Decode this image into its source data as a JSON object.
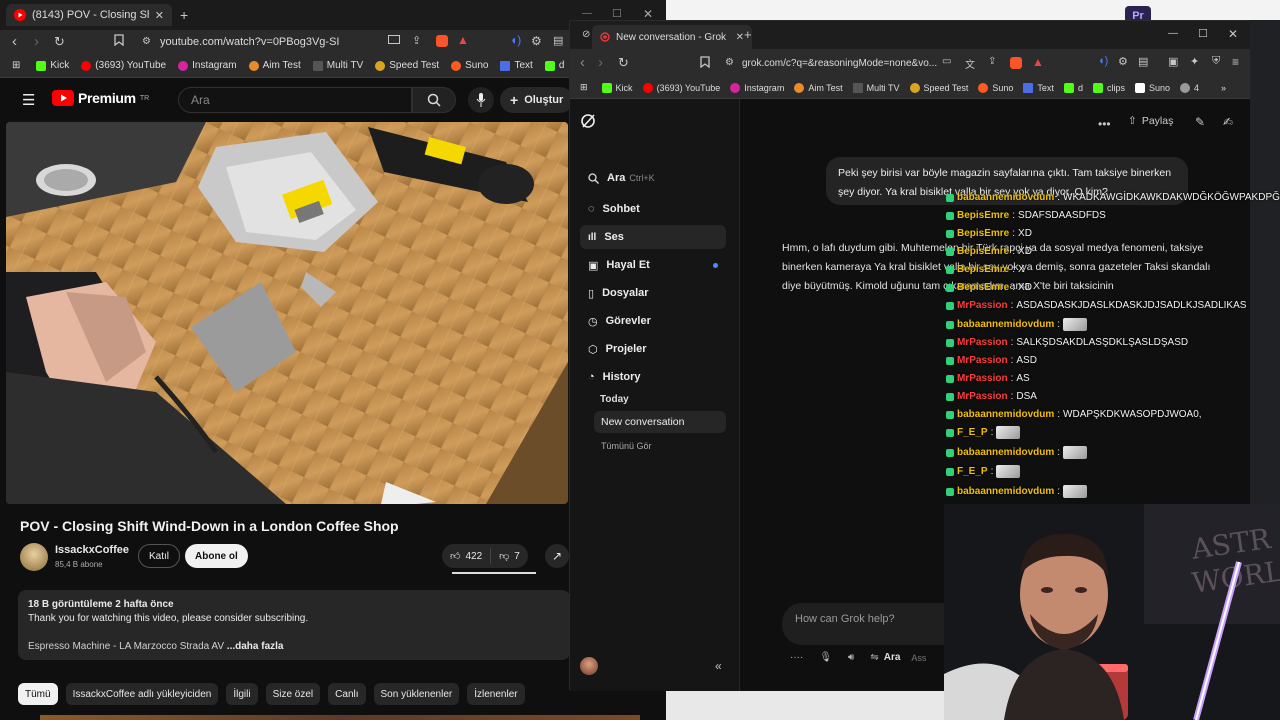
{
  "youtube": {
    "tab_title": "(8143) POV - Closing Shift Wind",
    "url": "youtube.com/watch?v=0PBog3Vg-SI",
    "bookmarks": [
      "Kick",
      "(3693) YouTube",
      "Instagram",
      "Aim Test",
      "Multi TV",
      "Speed Test",
      "Suno",
      "Text",
      "d",
      "clips"
    ],
    "logo": "Premium",
    "logo_sup": "TR",
    "search_placeholder": "Ara",
    "create_label": "Oluştur",
    "video_title": "POV - Closing Shift Wind-Down in a London Coffee Shop",
    "channel_name": "IssackxCoffee",
    "subscribers": "85,4 B abone",
    "join_label": "Katıl",
    "subscribe_label": "Abone ol",
    "likes": "422",
    "dislikes": "7",
    "desc_meta": "18 B görüntüleme  2 hafta önce",
    "desc_line": "Thank you for watching this video, please consider subscribing.",
    "desc_line2": "Espresso Machine - LA Marzocco Strada AV",
    "desc_more": "...daha fazla",
    "chips": [
      "Tümü",
      "IssackxCoffee adlı yükleyiciden",
      "İlgili",
      "Size özel",
      "Canlı",
      "Son yüklenenler",
      "İzlenenler"
    ]
  },
  "grok": {
    "tab_title": "New conversation - Grok",
    "url": "grok.com/c?q=&reasoningMode=none&vo...",
    "bookmarks": [
      "Kick",
      "(3693) YouTube",
      "Instagram",
      "Aim Test",
      "Multi TV",
      "Speed Test",
      "Suno",
      "Text",
      "d",
      "clips",
      "Suno",
      "4"
    ],
    "search_label": "Ara",
    "search_shortcut": "Ctrl+K",
    "nav": [
      "Sohbet",
      "Ses",
      "Hayal Et",
      "Dosyalar",
      "Görevler",
      "Projeler",
      "History"
    ],
    "today_label": "Today",
    "conversation_label": "New conversation",
    "see_all_label": "Tümünü Gör",
    "share_label": "Paylaş",
    "user_message": "Peki şey birisi var böyle magazin sayfalarına çıktı. Tam taksiye binerken şey diyor. Ya kral bisiklet valla bir şey yok ya diyor. O kim?",
    "assistant_message": "Hmm, o lafı duydum gibi. Muhtemelen bir Türk rapçi ya da sosyal medya fenomeni, taksiye binerken kameraya Ya kral bisiklet valla bir şey yok ya demiş, sonra gazeteler Taksi skandalı diye büyütmüş. Kimold uğunu tam çıkaramadım, ama X'te biri taksicinin",
    "prompt_placeholder": "How can Grok help?",
    "prompt_mode": "Ara",
    "prompt_mode_tail": "Ass"
  },
  "chat": [
    {
      "user": "babaannemidovdum",
      "color": "#f0c000",
      "msg": "WKADKAWGİDKAWKDAKWDĞKÖĞWPAKDPĞAWK",
      "emote": false
    },
    {
      "user": "BepisEmre",
      "color": "#f0c000",
      "msg": "SDAFSDAASDFDS",
      "emote": false
    },
    {
      "user": "BepisEmre",
      "color": "#f0c000",
      "msg": "XD",
      "emote": false
    },
    {
      "user": "BepisEmre",
      "color": "#f0c000",
      "msg": "XD",
      "emote": false
    },
    {
      "user": "BepisEmre",
      "color": "#f0c000",
      "msg": "X",
      "emote": false
    },
    {
      "user": "BepisEmre",
      "color": "#f0c000",
      "msg": "XD",
      "emote": false
    },
    {
      "user": "MrPassion",
      "color": "#ff3b3b",
      "msg": "ASDASDASKJDASLKDASKJDJSADLKJSADLIKAS",
      "emote": false
    },
    {
      "user": "babaannemidovdum",
      "color": "#f0c000",
      "msg": "",
      "emote": true
    },
    {
      "user": "MrPassion",
      "color": "#ff3b3b",
      "msg": "SALKŞDSAKDLASŞDKLŞASLDŞASD",
      "emote": false
    },
    {
      "user": "MrPassion",
      "color": "#ff3b3b",
      "msg": "ASD",
      "emote": false
    },
    {
      "user": "MrPassion",
      "color": "#ff3b3b",
      "msg": "AS",
      "emote": false
    },
    {
      "user": "MrPassion",
      "color": "#ff3b3b",
      "msg": "DSA",
      "emote": false
    },
    {
      "user": "babaannemidovdum",
      "color": "#f0c000",
      "msg": "WDAPŞKDKWASOPDJWOA0,",
      "emote": false
    },
    {
      "user": "F_E_P",
      "color": "#f0c000",
      "msg": "",
      "emote": true
    },
    {
      "user": "babaannemidovdum",
      "color": "#f0c000",
      "msg": "",
      "emote": true
    },
    {
      "user": "F_E_P",
      "color": "#f0c000",
      "msg": "",
      "emote": true
    },
    {
      "user": "babaannemidovdum",
      "color": "#f0c000",
      "msg": "",
      "emote": true
    }
  ]
}
